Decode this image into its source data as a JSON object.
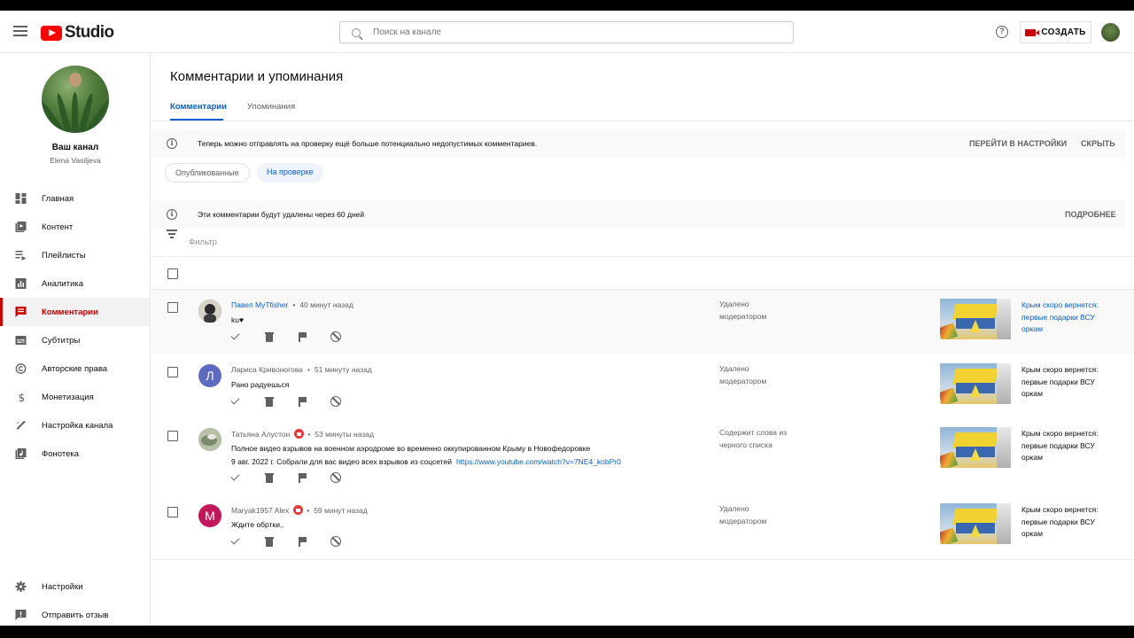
{
  "header": {
    "logo_text": "Studio",
    "search_placeholder": "Поиск на канале",
    "help_glyph": "?",
    "create_label": "СОЗДАТЬ"
  },
  "sidebar": {
    "channel_title": "Ваш канал",
    "channel_user": "Elena Vasiljeva",
    "items": [
      {
        "label": "Главная",
        "icon": "dashboard-icon"
      },
      {
        "label": "Контент",
        "icon": "content-icon"
      },
      {
        "label": "Плейлисты",
        "icon": "playlists-icon"
      },
      {
        "label": "Аналитика",
        "icon": "analytics-icon"
      },
      {
        "label": "Комментарии",
        "icon": "comments-icon"
      },
      {
        "label": "Субтитры",
        "icon": "subtitles-icon"
      },
      {
        "label": "Авторские права",
        "icon": "copyright-icon"
      },
      {
        "label": "Монетизация",
        "icon": "monetization-icon"
      },
      {
        "label": "Настройка канала",
        "icon": "customization-icon"
      },
      {
        "label": "Фонотека",
        "icon": "audio-library-icon"
      }
    ],
    "bottom_items": [
      {
        "label": "Настройки",
        "icon": "settings-icon"
      },
      {
        "label": "Отправить отзыв",
        "icon": "feedback-icon"
      }
    ]
  },
  "main": {
    "title": "Комментарии и упоминания",
    "tabs": [
      "Комментарии",
      "Упоминания"
    ],
    "notice": {
      "text": "Теперь можно отправлять на проверку ещё больше потенциально недопустимых комментариев.",
      "settings_link": "ПЕРЕЙТИ В НАСТРОЙКИ",
      "hide_link": "СКРЫТЬ"
    },
    "chips": [
      "Опубликованные",
      "На проверке"
    ],
    "delete_notice": {
      "text": "Эти комментарии будут удалены через 60 дней",
      "more_link": "ПОДРОБНЕЕ"
    },
    "filter_label": "Фильтр"
  },
  "comments": [
    {
      "author": "Павел MyTfisher",
      "time": "40 минут назад",
      "text_lines": [
        "ku♥"
      ],
      "status_lines": [
        "Удалено",
        "модератором"
      ],
      "video_title_lines": [
        "Крым скоро вернется:",
        "первые подарки ВСУ",
        "оркам"
      ],
      "avatar_letter": "",
      "avatar_color": "#3a3a3a"
    },
    {
      "author": "Лариса Кривоногова",
      "time": "51 минуту назад",
      "text_lines": [
        "Рано радуешься"
      ],
      "status_lines": [
        "Удалено",
        "модератором"
      ],
      "video_title_lines": [
        "Крым скоро вернется:",
        "первые подарки ВСУ",
        "оркам"
      ],
      "avatar_letter": "Л",
      "avatar_color": "#5c6bc0"
    },
    {
      "author": "Татьяна Алустон",
      "time": "53 минуты назад",
      "text_lines": [
        "Полное видео взрывов на военном аэродроме во временно оккупированном Крыму в Новофедоровке",
        "9 авг. 2022 г.  Собрали для вас видео всех взрывов из соцсетей"
      ],
      "link": "https://www.youtube.com/watch?v=7NE4_kobPr0",
      "status_lines": [
        "Содержит слова из",
        "черного списка"
      ],
      "video_title_lines": [
        "Крым скоро вернется:",
        "первые подарки ВСУ",
        "оркам"
      ],
      "avatar_letter": "",
      "avatar_color": "#8a9a7a"
    },
    {
      "author": "Maryak1957 Alex",
      "time": "59 минут назад",
      "text_lines": [
        "Ждите обртки,."
      ],
      "status_lines": [
        "Удалено",
        "модератором"
      ],
      "video_title_lines": [
        "Крым скоро вернется:",
        "первые подарки ВСУ",
        "оркам"
      ],
      "avatar_letter": "M",
      "avatar_color": "#c2185b"
    }
  ],
  "separator_dot": "•",
  "colors": {
    "accent_red": "#cc0000",
    "link_blue": "#065fd4"
  }
}
